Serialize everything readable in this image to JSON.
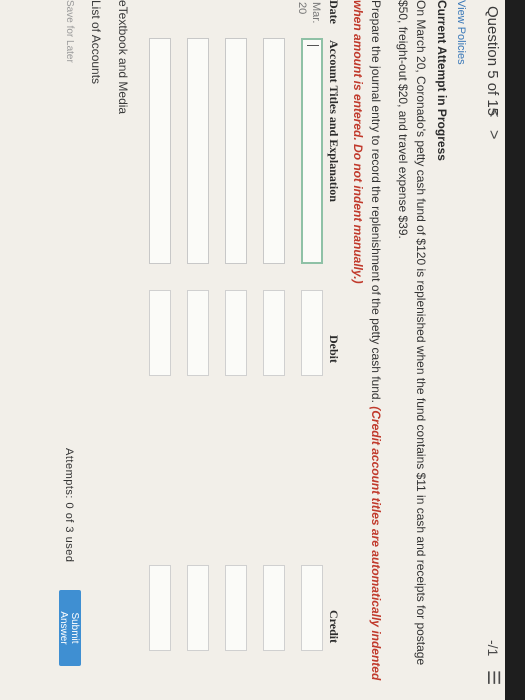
{
  "topbar": {
    "text": ""
  },
  "nav": {
    "question_label": "Question 5 of 15",
    "prev_glyph": "<",
    "next_glyph": ">",
    "score": "-/1",
    "menu_glyph": "☰"
  },
  "policies_link": "View Policies",
  "attempt_status": "Current Attempt in Progress",
  "problem_text": "On March 20, Coronado's petty cash fund of $120 is replenished when the fund contains $11 in cash and receipts for postage $50, freight-out $20, and travel expense $39.",
  "instructions": {
    "text": "Prepare the journal entry to record the replenishment of the petty cash fund.",
    "hint": "(Credit account titles are automatically indented when amount is entered. Do not indent manually.)"
  },
  "table": {
    "headers": {
      "date": "Date",
      "account": "Account Titles and Explanation",
      "debit": "Debit",
      "credit": "Credit"
    },
    "row": {
      "month": "Mar.",
      "day": "20"
    }
  },
  "links": {
    "etextbook": "eTextbook and Media",
    "accounts": "List of Accounts"
  },
  "footer": {
    "save_later": "Save for Later",
    "attempts": "Attempts: 0 of 3 used",
    "submit": "Submit Answer"
  },
  "colors": {
    "accent": "#3f8fd2",
    "hint": "#c0392b",
    "active_border": "#8fc1a6"
  }
}
